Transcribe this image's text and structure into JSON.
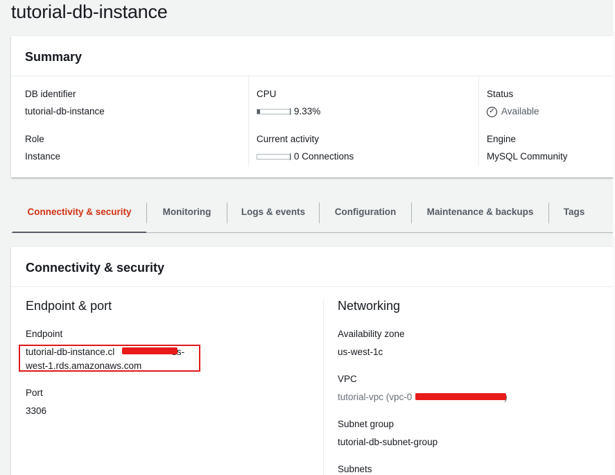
{
  "page": {
    "title": "tutorial-db-instance"
  },
  "summary": {
    "heading": "Summary",
    "db_identifier_label": "DB identifier",
    "db_identifier": "tutorial-db-instance",
    "role_label": "Role",
    "role": "Instance",
    "cpu_label": "CPU",
    "cpu_value": "9.33%",
    "cpu_fraction": 0.0933,
    "activity_label": "Current activity",
    "activity_value": "0 Connections",
    "activity_fraction": 0,
    "status_label": "Status",
    "status_value": "Available",
    "engine_label": "Engine",
    "engine_value": "MySQL Community"
  },
  "tabs": [
    {
      "label": "Connectivity & security",
      "active": true
    },
    {
      "label": "Monitoring"
    },
    {
      "label": "Logs & events"
    },
    {
      "label": "Configuration"
    },
    {
      "label": "Maintenance & backups"
    },
    {
      "label": "Tags"
    }
  ],
  "connectivity": {
    "heading": "Connectivity & security",
    "endpoint_port_heading": "Endpoint & port",
    "endpoint_label": "Endpoint",
    "endpoint_line1_prefix": "tutorial-db-instance.cl",
    "endpoint_line1_suffix": "us-",
    "endpoint_line2": "west-1.rds.amazonaws.com",
    "port_label": "Port",
    "port_value": "3306",
    "networking_heading": "Networking",
    "az_label": "Availability zone",
    "az_value": "us-west-1c",
    "vpc_label": "VPC",
    "vpc_prefix": "tutorial-vpc (vpc-0",
    "vpc_suffix": ")",
    "subnet_group_label": "Subnet group",
    "subnet_group_value": "tutorial-db-subnet-group",
    "subnets_label": "Subnets"
  },
  "colors": {
    "active_tab": "#d13212",
    "redaction": "#e81a1a"
  }
}
